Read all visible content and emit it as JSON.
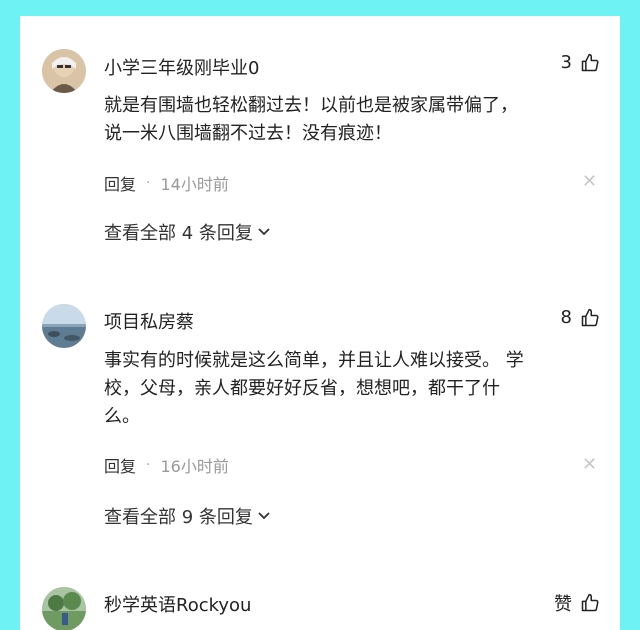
{
  "comments": [
    {
      "username": "小学三年级刚毕业0",
      "likes": "3",
      "text_lines": [
        "就是有围墙也轻松翻过去！以前也是被家属带偏了，",
        "说一米八围墙翻不过去！没有痕迹！"
      ],
      "reply_label": "回复",
      "separator": "·",
      "time": "14小时前",
      "view_replies": "查看全部 4 条回复",
      "avatar": "elderly-man-avatar"
    },
    {
      "username": "项目私房蔡",
      "likes": "8",
      "text_lines": [
        "事实有的时候就是这么简单，并且让人难以接受。 学",
        "校，父母，亲人都要好好反省，想想吧，都干了什",
        "么。"
      ],
      "reply_label": "回复",
      "separator": "·",
      "time": "16小时前",
      "view_replies": "查看全部 9 条回复",
      "avatar": "seascape-avatar"
    },
    {
      "username": "秒学英语Rockyou",
      "likes": "赞",
      "avatar": "park-avatar"
    }
  ],
  "icons": {
    "like": "thumbs-up-icon",
    "close": "close-icon",
    "expand": "chevron-down-icon"
  },
  "colors": {
    "background": "#6ef2f4",
    "panel": "#ffffff",
    "meta": "#999999"
  }
}
